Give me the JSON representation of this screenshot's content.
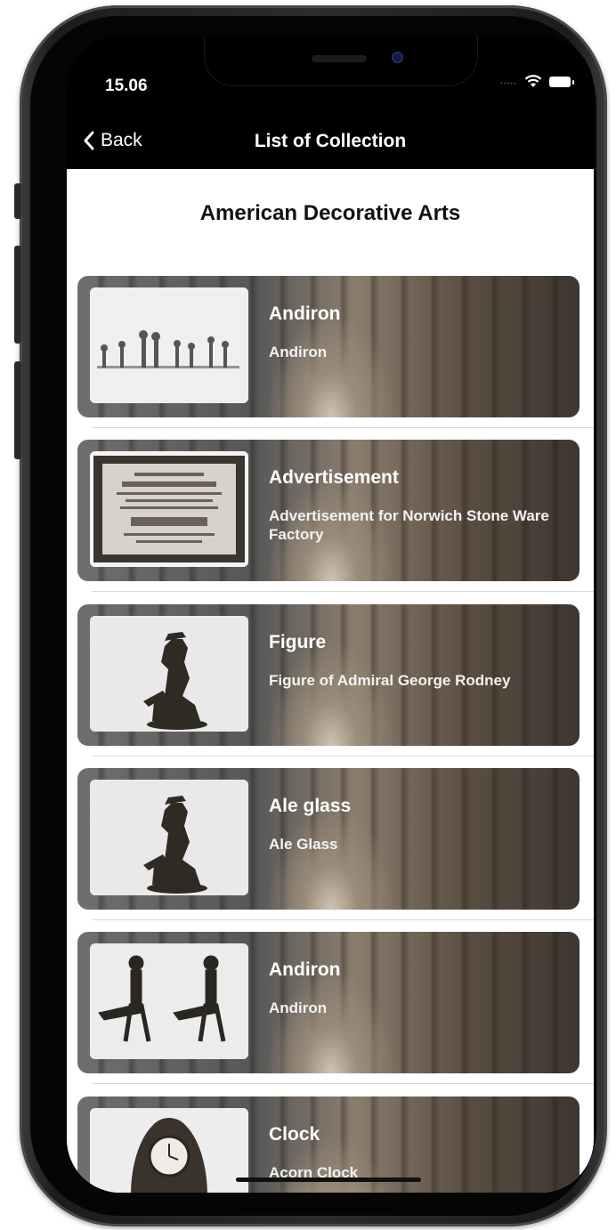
{
  "status_bar": {
    "time": "15.06"
  },
  "nav": {
    "back_label": "Back",
    "title": "List of Collection"
  },
  "page": {
    "heading": "American Decorative Arts"
  },
  "items": [
    {
      "title": "Andiron",
      "subtitle": "Andiron",
      "thumbnail": "andirons-row-image"
    },
    {
      "title": "Advertisement",
      "subtitle": "Advertisement for Norwich Stone Ware Factory",
      "thumbnail": "framed-advertisement-image"
    },
    {
      "title": "Figure",
      "subtitle": "Figure of Admiral George Rodney",
      "thumbnail": "admiral-figure-image"
    },
    {
      "title": "Ale glass",
      "subtitle": "Ale Glass",
      "thumbnail": "admiral-figure-image"
    },
    {
      "title": "Andiron",
      "subtitle": "Andiron",
      "thumbnail": "andiron-pair-image"
    },
    {
      "title": "Clock",
      "subtitle": "Acorn Clock",
      "thumbnail": "clock-image"
    }
  ],
  "colors": {
    "screen_bg": "#000000",
    "content_bg": "#ffffff",
    "text_on_card": "#ffffff"
  },
  "icons": {
    "back": "chevron-left-icon",
    "wifi": "wifi-icon",
    "battery": "battery-icon",
    "signal": "signal-dots-icon"
  }
}
